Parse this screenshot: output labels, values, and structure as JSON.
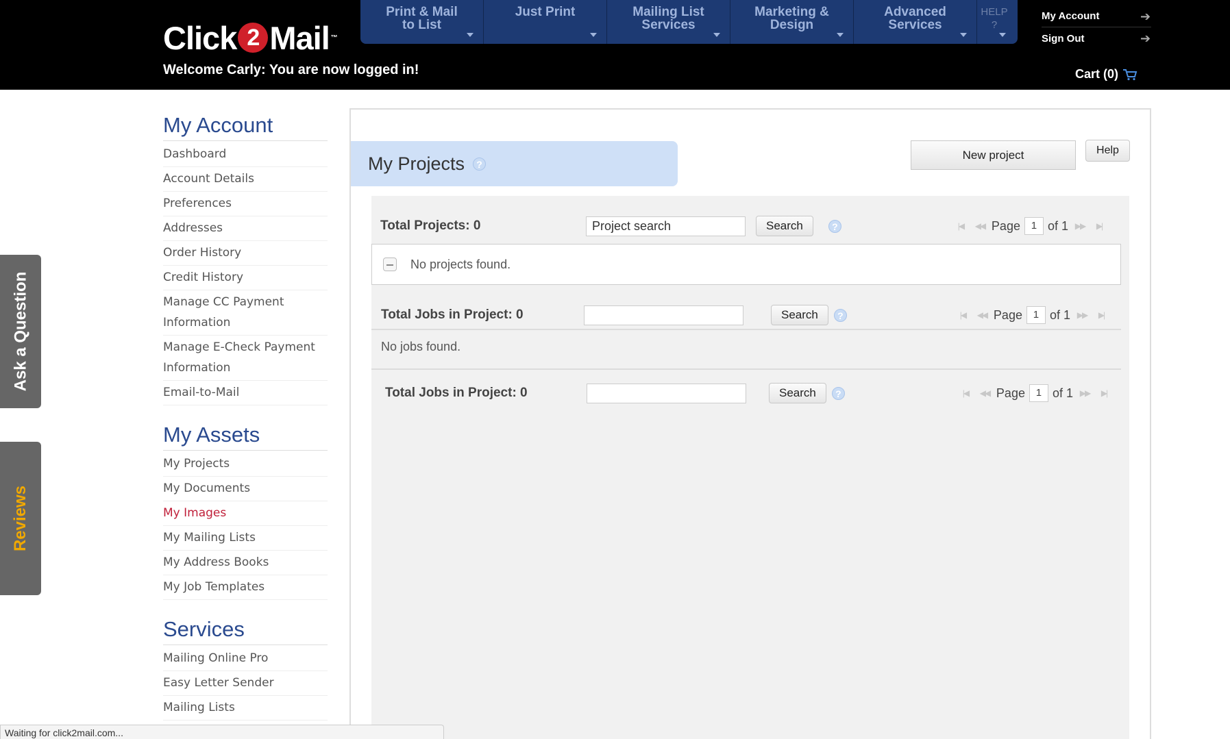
{
  "header": {
    "logo_pre": "Click",
    "logo_num": "2",
    "logo_post": "Mail",
    "welcome": "Welcome Carly: You are now logged in!",
    "nav": [
      {
        "label": "Print & Mail to List"
      },
      {
        "label": "Just Print"
      },
      {
        "label": "Mailing List Services"
      },
      {
        "label": "Marketing & Design"
      },
      {
        "label": "Advanced Services"
      },
      {
        "label": "HELP ?"
      }
    ],
    "my_account": "My Account",
    "sign_out": "Sign Out",
    "cart": "Cart (0)"
  },
  "side_tabs": {
    "question": "Ask a Question",
    "reviews": "Reviews"
  },
  "sidebar": {
    "account_title": "My Account",
    "account_items": [
      "Dashboard",
      "Account Details",
      "Preferences",
      "Addresses",
      "Order History",
      "Credit History",
      "Manage CC Payment Information",
      "Manage E-Check Payment Information",
      "Email-to-Mail"
    ],
    "assets_title": "My Assets",
    "assets_items": [
      "My Projects",
      "My Documents",
      "My Images",
      "My Mailing Lists",
      "My Address Books",
      "My Job Templates"
    ],
    "services_title": "Services",
    "services_items": [
      "Mailing Online Pro",
      "Easy Letter Sender",
      "Mailing Lists"
    ]
  },
  "main": {
    "title": "My Projects",
    "new_project_label": "New project",
    "help_label": "Help",
    "projects_bar": {
      "label": "Total Projects: 0",
      "search_value": "Project search",
      "search_label": "Search",
      "page_label": "Page",
      "page_value": "1",
      "page_of": "of 1"
    },
    "no_projects": "No projects found.",
    "jobs_bar_top": {
      "label": "Total Jobs in Project: 0",
      "search_value": "",
      "search_label": "Search",
      "page_label": "Page",
      "page_value": "1",
      "page_of": "of 1"
    },
    "no_jobs": "No jobs found.",
    "jobs_bar_bottom": {
      "label": "Total Jobs in Project: 0",
      "search_value": "",
      "search_label": "Search",
      "page_label": "Page",
      "page_value": "1",
      "page_of": "of 1"
    }
  },
  "status_bar": "Waiting for click2mail.com..."
}
